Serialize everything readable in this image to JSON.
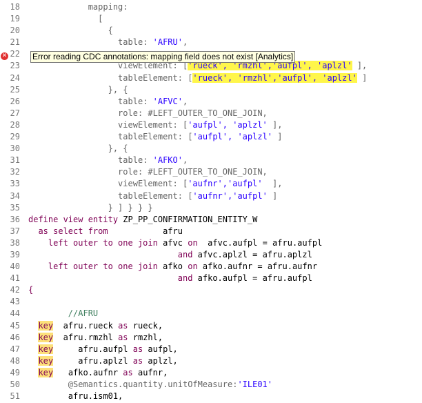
{
  "editor": {
    "error_tooltip": "Error reading CDC annotations: mapping field does not exist [Analytics]",
    "error_line": "22",
    "lines": [
      {
        "n": "18",
        "segs": [
          {
            "t": "            ",
            "c": "plain"
          },
          {
            "t": "mapping:",
            "c": "ann"
          }
        ]
      },
      {
        "n": "19",
        "segs": [
          {
            "t": "              [",
            "c": "ann"
          }
        ]
      },
      {
        "n": "20",
        "segs": [
          {
            "t": "                {",
            "c": "ann"
          }
        ]
      },
      {
        "n": "21",
        "segs": [
          {
            "t": "                  table: ",
            "c": "ann"
          },
          {
            "t": "'AFRU'",
            "c": "str"
          },
          {
            "t": ",",
            "c": "ann"
          }
        ]
      },
      {
        "n": "22",
        "segs": [
          {
            "t": "",
            "c": "plain"
          }
        ]
      },
      {
        "n": "23",
        "segs": [
          {
            "t": "                  viewElement: [",
            "c": "ann"
          },
          {
            "t": "'rueck', 'rmzhl','aufpl', 'aplzl'",
            "c": "str yel"
          },
          {
            "t": " ],",
            "c": "ann"
          }
        ]
      },
      {
        "n": "24",
        "segs": [
          {
            "t": "                  tableElement: [",
            "c": "ann"
          },
          {
            "t": "'rueck', 'rmzhl','aufpl', 'aplzl'",
            "c": "str yel"
          },
          {
            "t": " ]",
            "c": "ann"
          }
        ]
      },
      {
        "n": "25",
        "segs": [
          {
            "t": "                }, {",
            "c": "ann"
          }
        ]
      },
      {
        "n": "26",
        "segs": [
          {
            "t": "                  table: ",
            "c": "ann"
          },
          {
            "t": "'AFVC'",
            "c": "str"
          },
          {
            "t": ",",
            "c": "ann"
          }
        ]
      },
      {
        "n": "27",
        "segs": [
          {
            "t": "                  role: #LEFT_OUTER_TO_ONE_JOIN,",
            "c": "ann"
          }
        ]
      },
      {
        "n": "28",
        "segs": [
          {
            "t": "                  viewElement: [",
            "c": "ann"
          },
          {
            "t": "'aufpl', 'aplzl'",
            "c": "str"
          },
          {
            "t": " ],",
            "c": "ann"
          }
        ]
      },
      {
        "n": "29",
        "segs": [
          {
            "t": "                  tableElement: [",
            "c": "ann"
          },
          {
            "t": "'aufpl', 'aplzl'",
            "c": "str"
          },
          {
            "t": " ]",
            "c": "ann"
          }
        ]
      },
      {
        "n": "30",
        "segs": [
          {
            "t": "                }, {",
            "c": "ann"
          }
        ]
      },
      {
        "n": "31",
        "segs": [
          {
            "t": "                  table: ",
            "c": "ann"
          },
          {
            "t": "'AFKO'",
            "c": "str"
          },
          {
            "t": ",",
            "c": "ann"
          }
        ]
      },
      {
        "n": "32",
        "segs": [
          {
            "t": "                  role: #LEFT_OUTER_TO_ONE_JOIN,",
            "c": "ann"
          }
        ]
      },
      {
        "n": "33",
        "segs": [
          {
            "t": "                  viewElement: [",
            "c": "ann"
          },
          {
            "t": "'aufnr','aufpl'",
            "c": "str"
          },
          {
            "t": "  ],",
            "c": "ann"
          }
        ]
      },
      {
        "n": "34",
        "segs": [
          {
            "t": "                  tableElement: [",
            "c": "ann"
          },
          {
            "t": "'aufnr','aufpl'",
            "c": "str"
          },
          {
            "t": " ]",
            "c": "ann"
          }
        ]
      },
      {
        "n": "35",
        "segs": [
          {
            "t": "                } ] } } }",
            "c": "ann"
          }
        ]
      },
      {
        "n": "36",
        "segs": [
          {
            "t": "define view entity",
            "c": "kw"
          },
          {
            "t": " ZP_PP_CONFIRMATION_ENTITY_W",
            "c": "plain"
          }
        ]
      },
      {
        "n": "37",
        "segs": [
          {
            "t": "  ",
            "c": "plain"
          },
          {
            "t": "as select from",
            "c": "kw"
          },
          {
            "t": "           afru",
            "c": "plain"
          }
        ]
      },
      {
        "n": "38",
        "segs": [
          {
            "t": "    ",
            "c": "plain"
          },
          {
            "t": "left outer to one join",
            "c": "kw"
          },
          {
            "t": " afvc ",
            "c": "plain"
          },
          {
            "t": "on",
            "c": "kw"
          },
          {
            "t": "  afvc.aufpl = afru.aufpl",
            "c": "plain"
          }
        ]
      },
      {
        "n": "39",
        "segs": [
          {
            "t": "                              ",
            "c": "plain"
          },
          {
            "t": "and",
            "c": "kw"
          },
          {
            "t": " afvc.aplzl = afru.aplzl",
            "c": "plain"
          }
        ]
      },
      {
        "n": "40",
        "segs": [
          {
            "t": "    ",
            "c": "plain"
          },
          {
            "t": "left outer to one join",
            "c": "kw"
          },
          {
            "t": " afko ",
            "c": "plain"
          },
          {
            "t": "on",
            "c": "kw"
          },
          {
            "t": " afko.aufnr = afru.aufnr",
            "c": "plain"
          }
        ]
      },
      {
        "n": "41",
        "segs": [
          {
            "t": "                              ",
            "c": "plain"
          },
          {
            "t": "and",
            "c": "kw"
          },
          {
            "t": " afko.aufpl = afru.aufpl",
            "c": "plain"
          }
        ]
      },
      {
        "n": "42",
        "segs": [
          {
            "t": "{",
            "c": "kw"
          }
        ]
      },
      {
        "n": "43",
        "segs": [
          {
            "t": "",
            "c": "plain"
          }
        ]
      },
      {
        "n": "44",
        "segs": [
          {
            "t": "        //AFRU",
            "c": "cmt"
          }
        ]
      },
      {
        "n": "45",
        "segs": [
          {
            "t": "  ",
            "c": "plain"
          },
          {
            "t": "key",
            "c": "kw hl-key"
          },
          {
            "t": "  afru.rueck ",
            "c": "plain"
          },
          {
            "t": "as",
            "c": "kw"
          },
          {
            "t": " rueck,",
            "c": "plain"
          }
        ]
      },
      {
        "n": "46",
        "segs": [
          {
            "t": "  ",
            "c": "plain"
          },
          {
            "t": "key",
            "c": "kw hl-key"
          },
          {
            "t": "  afru.rmzhl ",
            "c": "plain"
          },
          {
            "t": "as",
            "c": "kw"
          },
          {
            "t": " rmzhl,",
            "c": "plain"
          }
        ]
      },
      {
        "n": "47",
        "segs": [
          {
            "t": "  ",
            "c": "plain"
          },
          {
            "t": "key",
            "c": "kw hl-key"
          },
          {
            "t": "     afru.aufpl ",
            "c": "plain"
          },
          {
            "t": "as",
            "c": "kw"
          },
          {
            "t": " aufpl,",
            "c": "plain"
          }
        ]
      },
      {
        "n": "48",
        "segs": [
          {
            "t": "  ",
            "c": "plain"
          },
          {
            "t": "key",
            "c": "kw hl-key"
          },
          {
            "t": "     afru.aplzl ",
            "c": "plain"
          },
          {
            "t": "as",
            "c": "kw"
          },
          {
            "t": " aplzl,",
            "c": "plain"
          }
        ]
      },
      {
        "n": "49",
        "segs": [
          {
            "t": "  ",
            "c": "plain"
          },
          {
            "t": "key",
            "c": "kw hl-key"
          },
          {
            "t": "   afko.aufnr ",
            "c": "plain"
          },
          {
            "t": "as",
            "c": "kw"
          },
          {
            "t": " aufnr,",
            "c": "plain"
          }
        ]
      },
      {
        "n": "50",
        "segs": [
          {
            "t": "        @Semantics.quantity.unitOfMeasure:",
            "c": "ann"
          },
          {
            "t": "'ILE01'",
            "c": "str"
          }
        ]
      },
      {
        "n": "51",
        "segs": [
          {
            "t": "        afru.ism01,",
            "c": "plain"
          }
        ]
      }
    ]
  }
}
